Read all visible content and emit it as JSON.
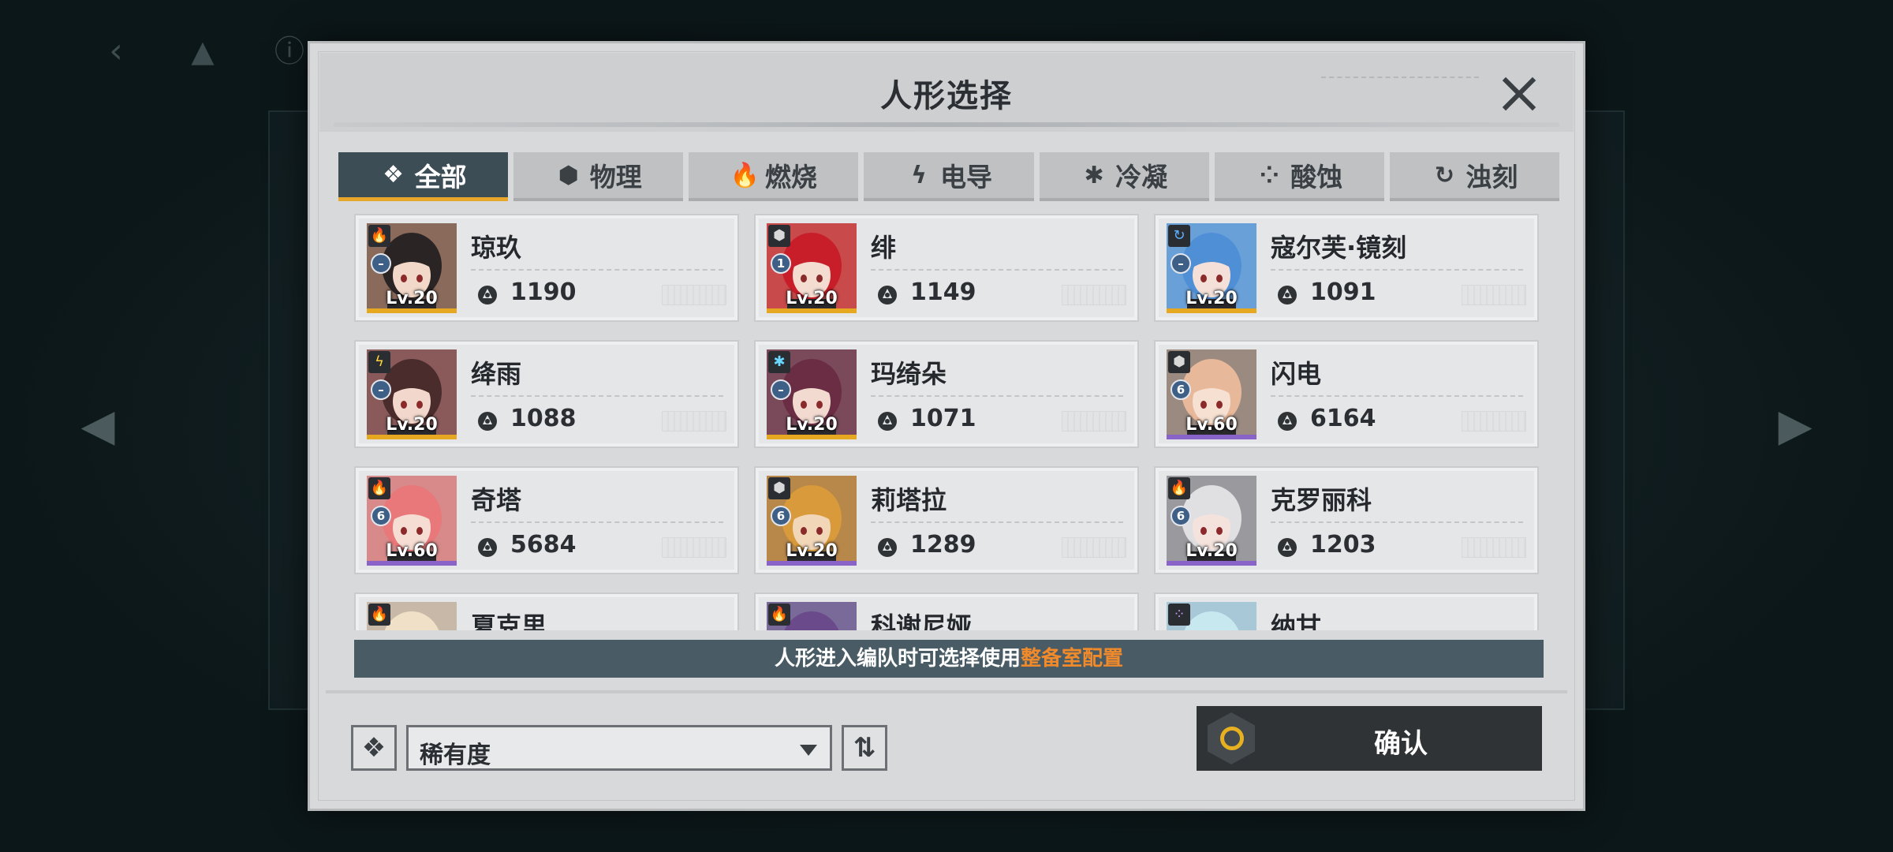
{
  "modal": {
    "title": "人形选择",
    "notice_text": "人形进入编队时可选择使用",
    "notice_highlight": "整备室配置",
    "sort_label": "稀有度",
    "confirm_label": "确认",
    "order_symbol": "⇅"
  },
  "tabs": [
    {
      "label": "全部",
      "icon": "❖",
      "icon_name": "all-icon",
      "active": true
    },
    {
      "label": "物理",
      "icon": "⬢",
      "icon_name": "physical-icon",
      "active": false
    },
    {
      "label": "燃烧",
      "icon": "🔥",
      "icon_name": "burn-icon",
      "active": false
    },
    {
      "label": "电导",
      "icon": "ϟ",
      "icon_name": "electric-icon",
      "active": false
    },
    {
      "label": "冷凝",
      "icon": "✱",
      "icon_name": "freeze-icon",
      "active": false
    },
    {
      "label": "酸蚀",
      "icon": "⁘",
      "icon_name": "corrosion-icon",
      "active": false
    },
    {
      "label": "浊刻",
      "icon": "↻",
      "icon_name": "hydro-icon",
      "active": false
    }
  ],
  "characters": [
    {
      "name": "琼玖",
      "level": "Lv.20",
      "power": "1190",
      "element": "burn",
      "rank": "–",
      "rarity": "gold",
      "hair": "#2a2424",
      "skin": "#f2d8c8",
      "bg": "#8a6a5a"
    },
    {
      "name": "绯",
      "level": "Lv.20",
      "power": "1149",
      "element": "physical",
      "rank": "1",
      "rarity": "gold",
      "hair": "#c81e2a",
      "skin": "#f5dcd0",
      "bg": "#c84a4a"
    },
    {
      "name": "寇尔芙·镜刻",
      "level": "Lv.20",
      "power": "1091",
      "element": "hydro",
      "rank": "–",
      "rarity": "gold",
      "hair": "#4f8fd6",
      "skin": "#f4e0d8",
      "bg": "#6aa0d8"
    },
    {
      "name": "绛雨",
      "level": "Lv.20",
      "power": "1088",
      "element": "electric",
      "rank": "–",
      "rarity": "gold",
      "hair": "#4a2c2c",
      "skin": "#f2d8cc",
      "bg": "#8a5a5a"
    },
    {
      "name": "玛绮朵",
      "level": "Lv.20",
      "power": "1071",
      "element": "freeze",
      "rank": "–",
      "rarity": "gold",
      "hair": "#6a2d44",
      "skin": "#f2dad0",
      "bg": "#7a4a5a"
    },
    {
      "name": "闪电",
      "level": "Lv.60",
      "power": "6164",
      "element": "physical",
      "rank": "6",
      "rarity": "purple",
      "hair": "#e8b89a",
      "skin": "#f6e0d2",
      "bg": "#9a8a80"
    },
    {
      "name": "奇塔",
      "level": "Lv.60",
      "power": "5684",
      "element": "burn",
      "rank": "6",
      "rarity": "purple",
      "hair": "#e8787a",
      "skin": "#f6ddd4",
      "bg": "#d88a8a"
    },
    {
      "name": "莉塔拉",
      "level": "Lv.20",
      "power": "1289",
      "element": "physical",
      "rank": "6",
      "rarity": "purple",
      "hair": "#d89a3a",
      "skin": "#f2d6b8",
      "bg": "#b8884a"
    },
    {
      "name": "克罗丽科",
      "level": "Lv.20",
      "power": "1203",
      "element": "burn",
      "rank": "6",
      "rarity": "purple",
      "hair": "#e0e0e2",
      "skin": "#f4e2dc",
      "bg": "#9a9a9e"
    },
    {
      "name": "夏克里",
      "level": "",
      "power": "",
      "element": "burn",
      "rank": "",
      "rarity": "purple",
      "hair": "#f0e0c8",
      "skin": "#f4e0d0",
      "bg": "#c8b8a8"
    },
    {
      "name": "科谢尼娅",
      "level": "",
      "power": "",
      "element": "burn",
      "rank": "",
      "rarity": "purple",
      "hair": "#6a4a8a",
      "skin": "#f2dad0",
      "bg": "#7a6a9a"
    },
    {
      "name": "纳甘",
      "level": "",
      "power": "",
      "element": "corrosion",
      "rank": "",
      "rarity": "purple",
      "hair": "#c8e8f0",
      "skin": "#f4e2dc",
      "bg": "#a8c8d8"
    }
  ],
  "colors": {
    "gold_bar": "#e6a821",
    "purple_bar": "#8a63c9",
    "accent": "#e8a62b",
    "highlight": "#f08a2a"
  }
}
